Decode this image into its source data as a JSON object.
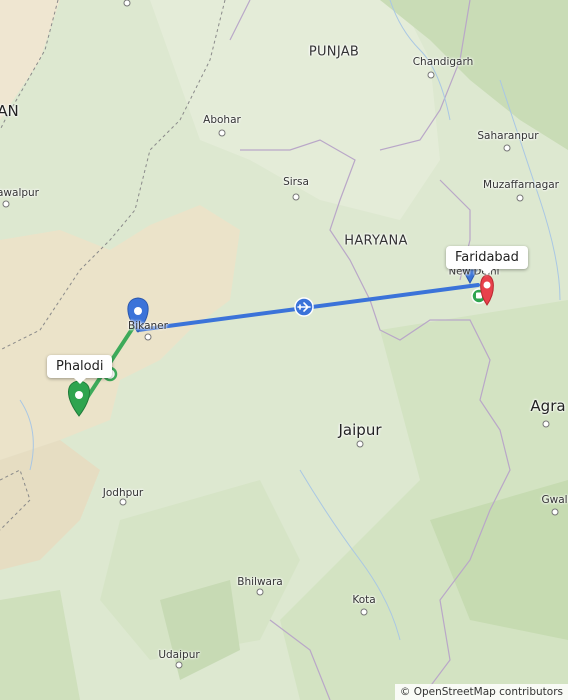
{
  "map": {
    "places": [
      {
        "id": "punjab",
        "label": "PUNJAB"
      },
      {
        "id": "haryana",
        "label": "HARYANA"
      },
      {
        "id": "chandigarh",
        "label": "Chandigarh"
      },
      {
        "id": "abohar",
        "label": "Abohar"
      },
      {
        "id": "saharanpur",
        "label": "Saharanpur"
      },
      {
        "id": "sirsa",
        "label": "Sirsa"
      },
      {
        "id": "muzaffarnagar",
        "label": "Muzaffarnagar"
      },
      {
        "id": "bahawalpur",
        "label": "awalpur"
      },
      {
        "id": "pakistan",
        "label": "AN"
      },
      {
        "id": "bikaner",
        "label": "Bikaner"
      },
      {
        "id": "jaipur",
        "label": "Jaipur"
      },
      {
        "id": "agra",
        "label": "Agra"
      },
      {
        "id": "gwalior",
        "label": "Gwali"
      },
      {
        "id": "jodhpur",
        "label": "Jodhpur"
      },
      {
        "id": "bhilwara",
        "label": "Bhilwara"
      },
      {
        "id": "kota",
        "label": "Kota"
      },
      {
        "id": "udaipur",
        "label": "Udaipur"
      },
      {
        "id": "newdelhi",
        "label": "New Delhi"
      }
    ],
    "markers": {
      "origin_label": "Phalodi",
      "destination_label": "Faridabad",
      "origin_color": "#2ea44f",
      "destination_color": "#e8414b",
      "stop_color": "#3b73d9"
    },
    "route": {
      "drive_color": "#3daa5a",
      "flight_color": "#3b73d9",
      "flight_icon": "airplane-icon",
      "transit_icon": "bus-icon"
    },
    "attribution": "© OpenStreetMap contributors"
  }
}
